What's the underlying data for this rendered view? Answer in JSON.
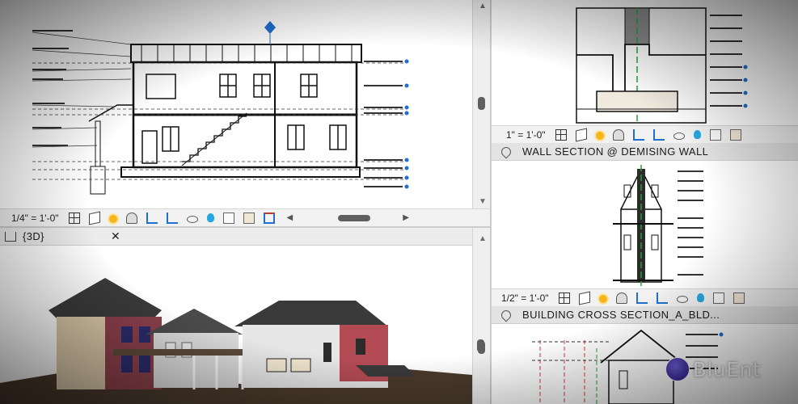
{
  "elevation_view": {
    "scale": "1/4\" = 1'-0\""
  },
  "view3d": {
    "label": "{3D}",
    "close": "✕"
  },
  "wall_detail": {
    "scale": "1\" = 1'-0\""
  },
  "demising": {
    "title": "WALL SECTION @ DEMISING WALL",
    "scale": "1/2\" = 1'-0\""
  },
  "cross_section": {
    "title": "BUILDING CROSS SECTION_A_BLD..."
  },
  "brand": {
    "text": "BluEnt",
    "reg": "®"
  },
  "colors": {
    "accent_blue": "#1f6fd0",
    "roof_dark": "#3a3a3a",
    "brick_red": "#b34b55",
    "green_line": "#22a33a",
    "red_line": "#d83a3a"
  },
  "icons": [
    "grid-icon",
    "cube-icon",
    "sun-icon",
    "shadow-icon",
    "crop-icon",
    "crop-region-icon",
    "eye-icon",
    "bulb-icon",
    "tag-icon",
    "house-icon",
    "reveal-icon"
  ]
}
